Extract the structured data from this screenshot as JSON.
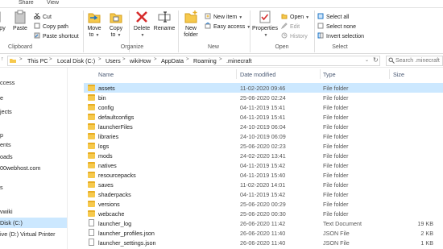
{
  "ribbon_tabs": [
    "Share",
    "View"
  ],
  "ribbon": {
    "clipboard": {
      "copy_label": "py",
      "paste_label": "Paste",
      "cut": "Cut",
      "copy_path": "Copy path",
      "paste_shortcut": "Paste shortcut",
      "group": "Clipboard"
    },
    "organize": {
      "move_to": [
        "Move",
        "to"
      ],
      "copy_to": [
        "Copy",
        "to"
      ],
      "delete": "Delete",
      "rename": "Rename",
      "group": "Organize"
    },
    "new": {
      "new_folder": [
        "New",
        "folder"
      ],
      "new_item": "New item",
      "easy_access": "Easy access",
      "group": "New"
    },
    "open": {
      "properties": "Properties",
      "open": "Open",
      "edit": "Edit",
      "history": "History",
      "group": "Open"
    },
    "select": {
      "select_all": "Select all",
      "select_none": "Select none",
      "invert_selection": "Invert selection",
      "group": "Select"
    }
  },
  "breadcrumb": [
    "This PC",
    "Local Disk (C:)",
    "Users",
    "wikiHow",
    "AppData",
    "Roaming",
    ".minecraft"
  ],
  "search": {
    "placeholder": "Search .minecraft"
  },
  "nav_items": [
    {
      "label": "ccess",
      "selected": false
    },
    {
      "label": "",
      "selected": false
    },
    {
      "label": "e",
      "selected": false
    },
    {
      "label": "jects",
      "selected": false
    },
    {
      "label": "p",
      "selected": false
    },
    {
      "label": "ents",
      "selected": false
    },
    {
      "label": "oads",
      "selected": false
    },
    {
      "label": "00webhost.com",
      "selected": false
    },
    {
      "label": "",
      "selected": false
    },
    {
      "label": "s",
      "selected": false
    },
    {
      "label": "",
      "selected": false
    },
    {
      "label": "vwiki",
      "selected": false
    },
    {
      "label": "Disk (C:)",
      "selected": true
    },
    {
      "label": "ive (D:) Virtual Printer",
      "selected": false
    },
    {
      "label": "",
      "selected": false
    }
  ],
  "columns": {
    "name": "Name",
    "date": "Date modified",
    "type": "Type",
    "size": "Size"
  },
  "files": [
    {
      "name": "assets",
      "date": "11-02-2020 09:46",
      "type": "File folder",
      "size": "",
      "kind": "folder",
      "selected": true
    },
    {
      "name": "bin",
      "date": "25-06-2020 02:24",
      "type": "File folder",
      "size": "",
      "kind": "folder",
      "selected": false
    },
    {
      "name": "config",
      "date": "04-11-2019 15:41",
      "type": "File folder",
      "size": "",
      "kind": "folder",
      "selected": false
    },
    {
      "name": "defaultconfigs",
      "date": "04-11-2019 15:41",
      "type": "File folder",
      "size": "",
      "kind": "folder",
      "selected": false
    },
    {
      "name": "launcherFiles",
      "date": "24-10-2019 06:04",
      "type": "File folder",
      "size": "",
      "kind": "folder",
      "selected": false
    },
    {
      "name": "libraries",
      "date": "24-10-2019 06:09",
      "type": "File folder",
      "size": "",
      "kind": "folder",
      "selected": false
    },
    {
      "name": "logs",
      "date": "25-06-2020 02:23",
      "type": "File folder",
      "size": "",
      "kind": "folder",
      "selected": false
    },
    {
      "name": "mods",
      "date": "24-02-2020 13:41",
      "type": "File folder",
      "size": "",
      "kind": "folder",
      "selected": false
    },
    {
      "name": "natives",
      "date": "04-11-2019 15:42",
      "type": "File folder",
      "size": "",
      "kind": "folder",
      "selected": false
    },
    {
      "name": "resourcepacks",
      "date": "04-11-2019 15:40",
      "type": "File folder",
      "size": "",
      "kind": "folder",
      "selected": false
    },
    {
      "name": "saves",
      "date": "11-02-2020 14:01",
      "type": "File folder",
      "size": "",
      "kind": "folder",
      "selected": false
    },
    {
      "name": "shaderpacks",
      "date": "04-11-2019 15:42",
      "type": "File folder",
      "size": "",
      "kind": "folder",
      "selected": false
    },
    {
      "name": "versions",
      "date": "25-06-2020 00:29",
      "type": "File folder",
      "size": "",
      "kind": "folder",
      "selected": false
    },
    {
      "name": "webcache",
      "date": "25-06-2020 00:30",
      "type": "File folder",
      "size": "",
      "kind": "folder",
      "selected": false
    },
    {
      "name": "launcher_log",
      "date": "26-06-2020 11:42",
      "type": "Text Document",
      "size": "19 KB",
      "kind": "file",
      "selected": false
    },
    {
      "name": "launcher_profiles.json",
      "date": "26-06-2020 11:40",
      "type": "JSON File",
      "size": "2 KB",
      "kind": "file",
      "selected": false
    },
    {
      "name": "launcher_settings.json",
      "date": "26-06-2020 11:40",
      "type": "JSON File",
      "size": "1 KB",
      "kind": "file",
      "selected": false
    }
  ],
  "colors": {
    "selection": "#cce8ff",
    "folder": "#f6c94d",
    "accent": "#1e74c6"
  }
}
